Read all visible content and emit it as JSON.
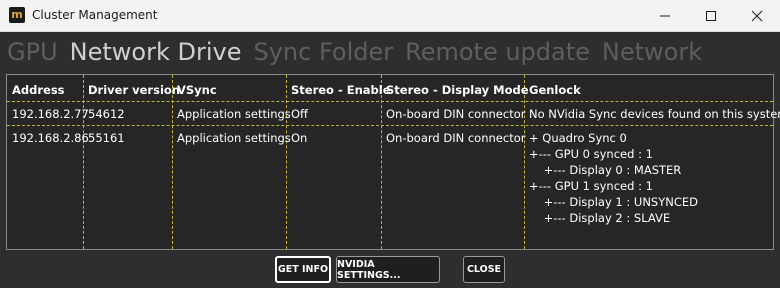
{
  "window": {
    "title": "Cluster Management",
    "icon": "m"
  },
  "tabs": [
    {
      "label": "GPU",
      "active": false
    },
    {
      "label": "Network Drive",
      "active": true
    },
    {
      "label": "Sync Folder",
      "active": false
    },
    {
      "label": "Remote update",
      "active": false
    },
    {
      "label": "Network",
      "active": false
    }
  ],
  "table": {
    "headers": [
      "Address",
      "Driver version",
      "VSync",
      "Stereo - Enable",
      "Stereo - Display Mode",
      "Genlock"
    ],
    "rows": [
      {
        "address": "192.168.2.77",
        "driver": "54612",
        "vsync": "Application settings",
        "stereo_enable": "Off",
        "display_mode": "On-board DIN connector",
        "genlock": [
          "No NVidia Sync devices found on this system"
        ]
      },
      {
        "address": "192.168.2.86",
        "driver": "55161",
        "vsync": "Application settings",
        "stereo_enable": "On",
        "display_mode": "On-board DIN connector",
        "genlock": [
          "+ Quadro Sync 0",
          "+--- GPU 0 synced : 1",
          "    +--- Display 0 : MASTER",
          "+--- GPU 1 synced : 1",
          "    +--- Display 1 : UNSYNCED",
          "    +--- Display 2 : SLAVE"
        ]
      }
    ]
  },
  "buttons": {
    "get_info": "GET INFO",
    "nvidia_settings": "NVIDIA SETTINGS...",
    "close": "CLOSE"
  },
  "colors": {
    "background": "#2e2e2e",
    "grid_line": "#c6b03c",
    "active_tab": "#cfcfcf",
    "inactive_tab": "#5e5e5e"
  }
}
